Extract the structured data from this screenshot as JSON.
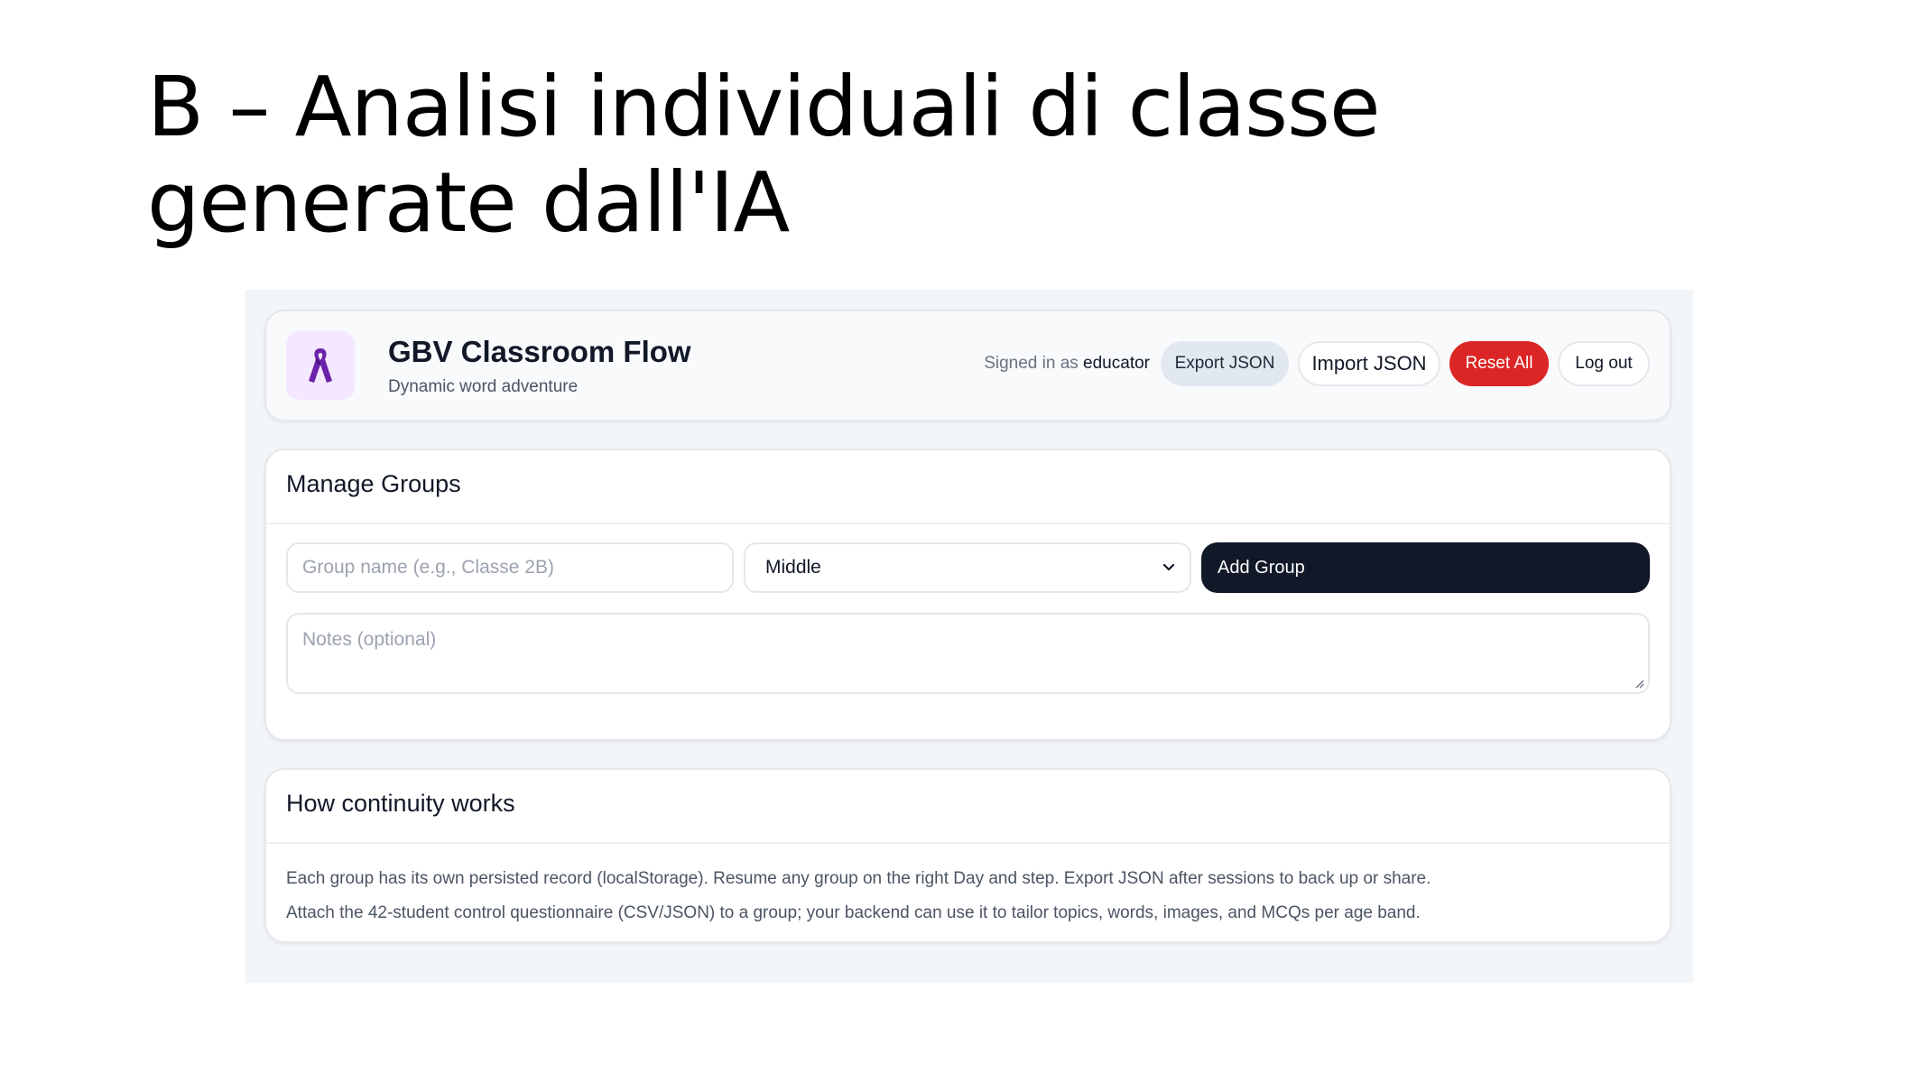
{
  "slide": {
    "title": "B – Analisi individuali di classe generate dall'IA"
  },
  "app": {
    "name": "GBV Classroom Flow",
    "tagline": "Dynamic word adventure",
    "logo_icon": "ribbon-icon",
    "signed_in_prefix": "Signed in as",
    "signed_in_user": "educator",
    "buttons": {
      "export": "Export JSON",
      "import": "Import JSON",
      "reset": "Reset All",
      "logout": "Log out"
    }
  },
  "manage_groups": {
    "title": "Manage Groups",
    "group_name_placeholder": "Group name (e.g., Classe 2B)",
    "level_selected": "Middle",
    "add_button": "Add Group",
    "notes_placeholder": "Notes (optional)"
  },
  "continuity": {
    "title": "How continuity works",
    "lines": [
      "Each group has its own persisted record (localStorage). Resume any group on the right Day and step. Export JSON after sessions to back up or share.",
      "Attach the 42-student control questionnaire (CSV/JSON) to a group; your backend can use it to tailor topics, words, images, and MCQs per age band."
    ]
  },
  "colors": {
    "accent_dark": "#111827",
    "danger": "#dc2626",
    "logo_bg": "#f3e8ff",
    "ribbon": "#6b21a8"
  }
}
